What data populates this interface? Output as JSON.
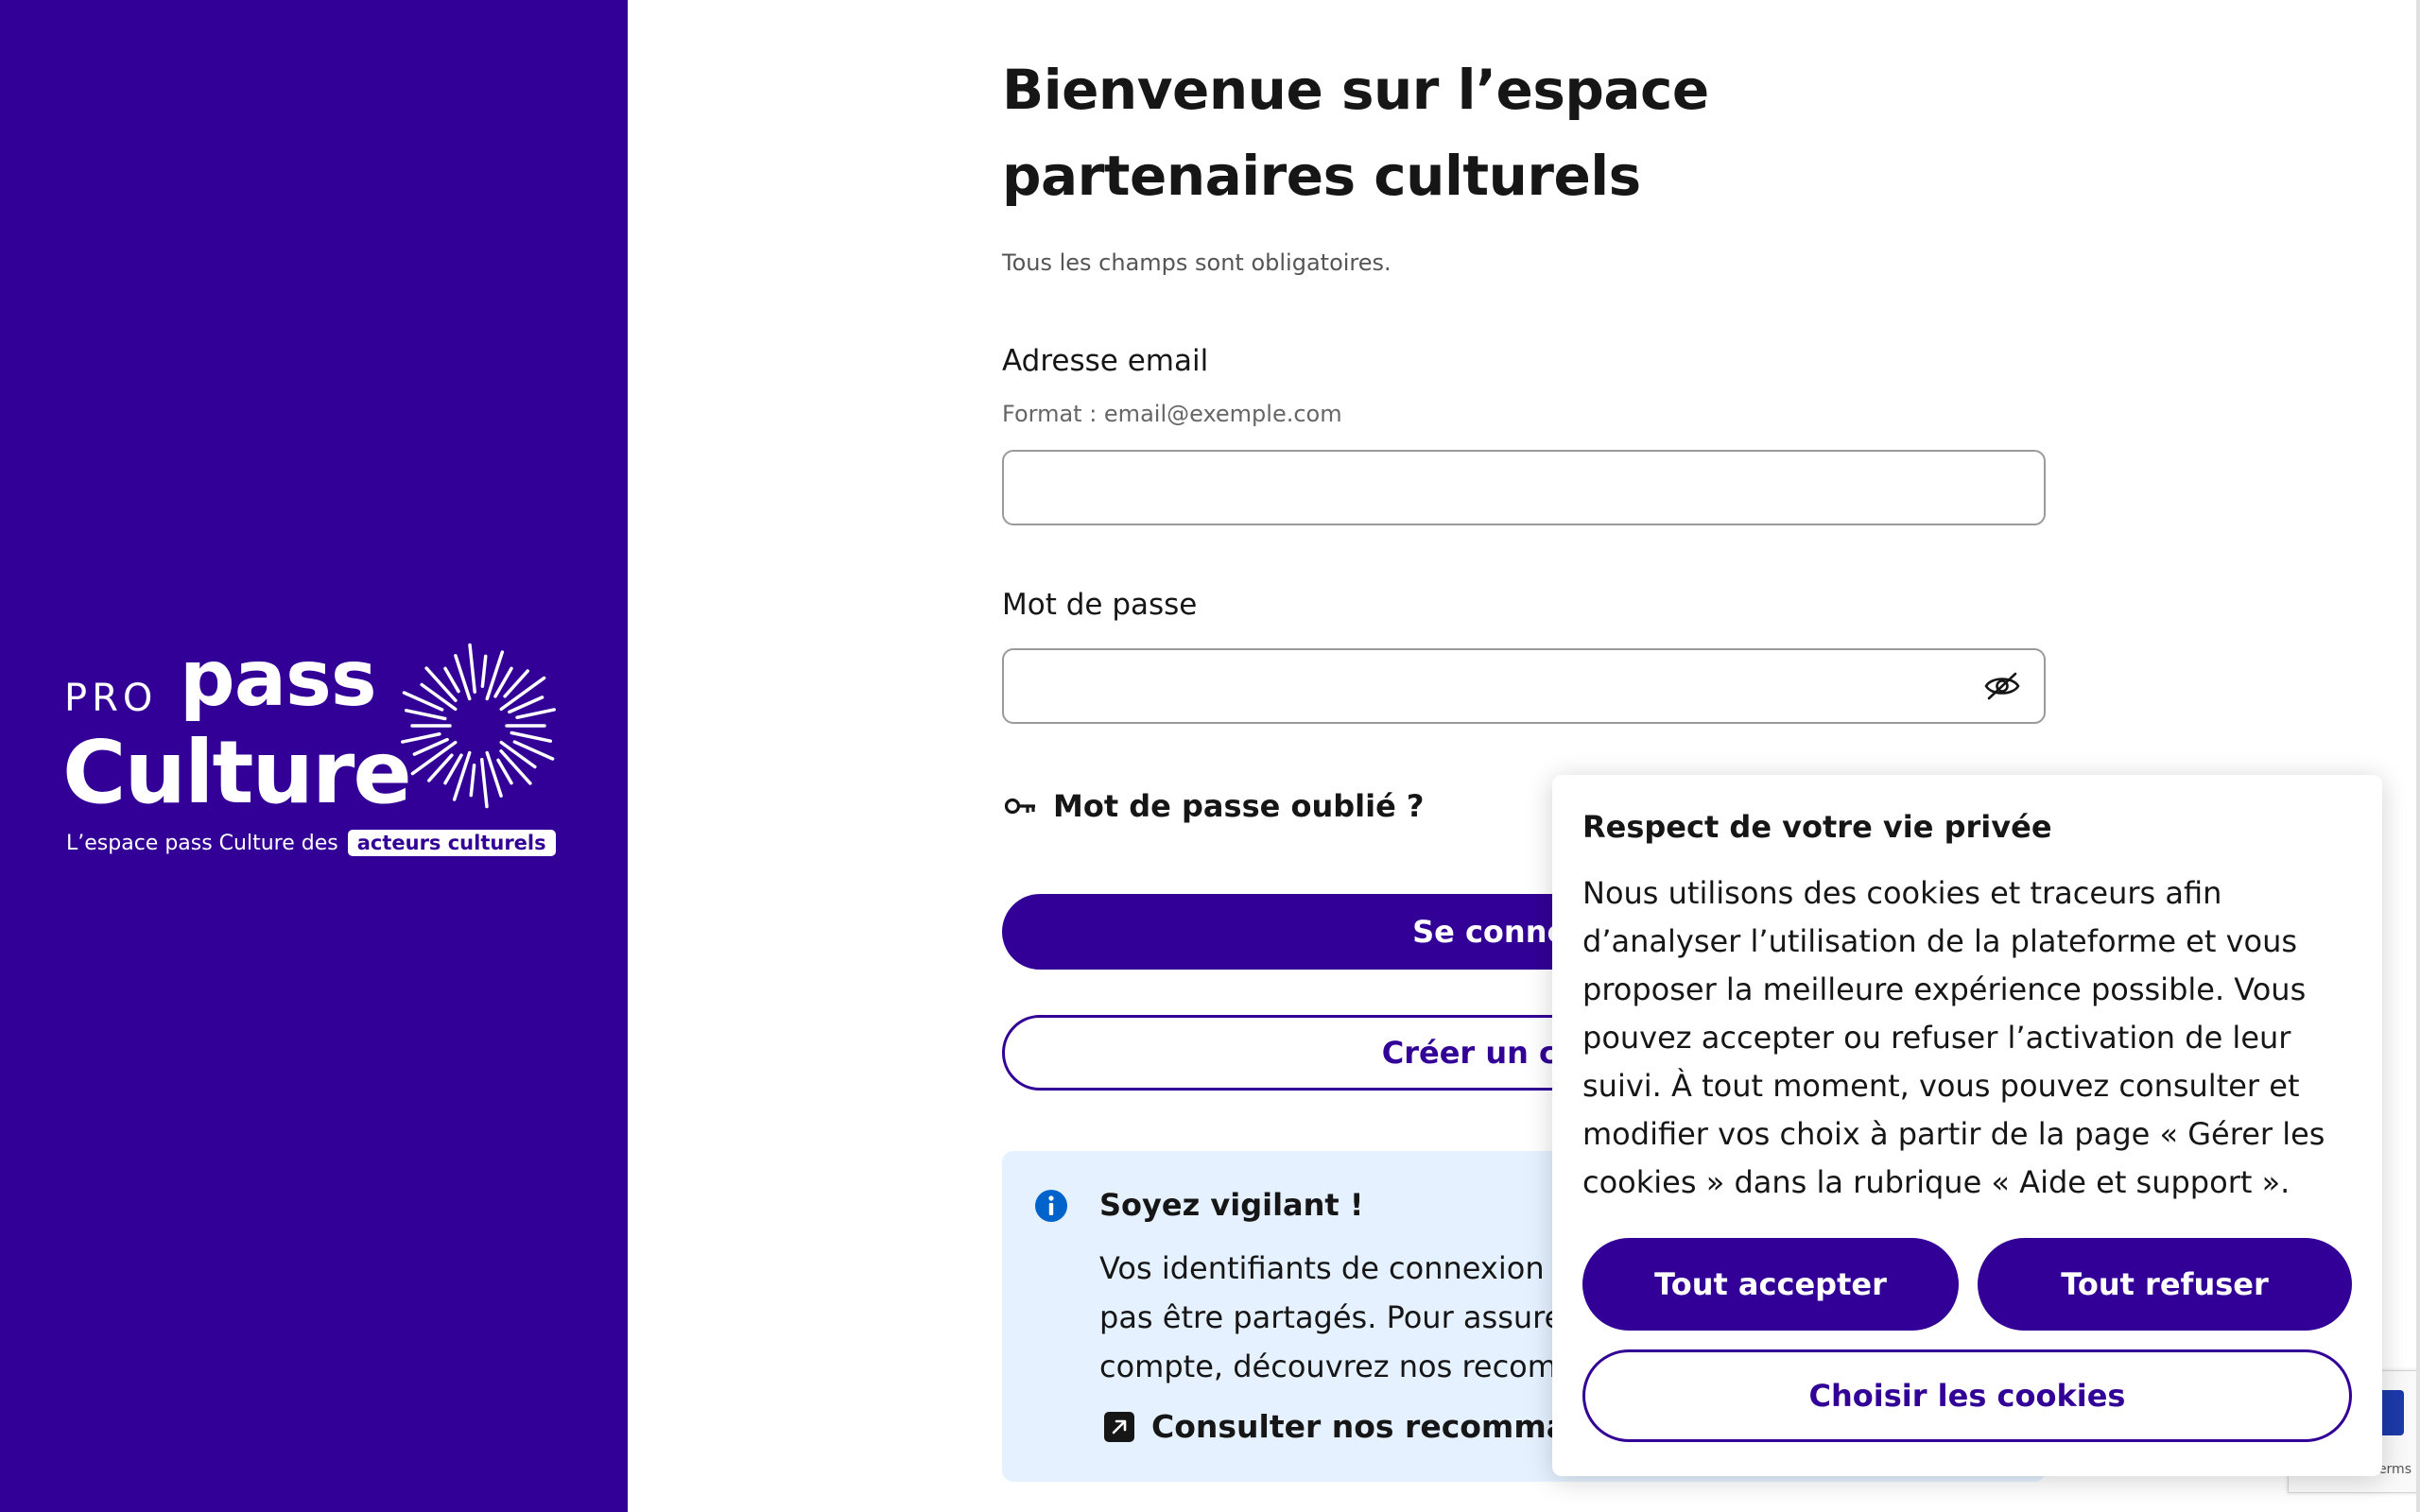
{
  "brand": {
    "pro": "PRO",
    "pass": "pass",
    "culture": "Culture",
    "tagline_prefix": "L’espace pass Culture des",
    "tagline_highlight": "acteurs culturels",
    "panel_color": "#320096"
  },
  "form": {
    "title": "Bienvenue sur l’espace partenaires culturels",
    "required_hint": "Tous les champs sont obligatoires.",
    "email_label": "Adresse email",
    "email_hint": "Format : email@exemple.com",
    "email_value": "",
    "password_label": "Mot de passe",
    "password_value": "",
    "password_toggle_icon": "eye-slash-icon",
    "forgot_password": "Mot de passe oublié ?",
    "forgot_icon": "key-icon",
    "login_button": "Se connecter",
    "create_account_button": "Créer un compte"
  },
  "callout": {
    "icon": "info-icon",
    "title": "Soyez vigilant !",
    "text": "Vos identifiants de connexion sont personnels et ne doivent pas être partagés. Pour assurer la protection de votre compte, découvrez nos recommandations.",
    "link_label": "Consulter nos recommandations",
    "link_icon": "external-link-icon",
    "background": "#e5f1ff"
  },
  "cookie_banner": {
    "title": "Respect de votre vie privée",
    "text": "Nous utilisons des cookies et traceurs afin d’analyser l’utilisation de la plateforme et vous proposer la meilleure expérience possible. Vous pouvez accepter ou refuser l’activation de leur suivi. À tout moment, vous pouvez consulter et modifier vos choix à partir de la page « Gérer les cookies » dans la rubrique « Aide et support ».",
    "accept_all": "Tout accepter",
    "refuse_all": "Tout refuser",
    "choose": "Choisir les cookies"
  },
  "recaptcha": {
    "text": "Terms"
  },
  "colors": {
    "primary": "#320096",
    "text": "#161617",
    "info_blue": "#0063cb"
  }
}
